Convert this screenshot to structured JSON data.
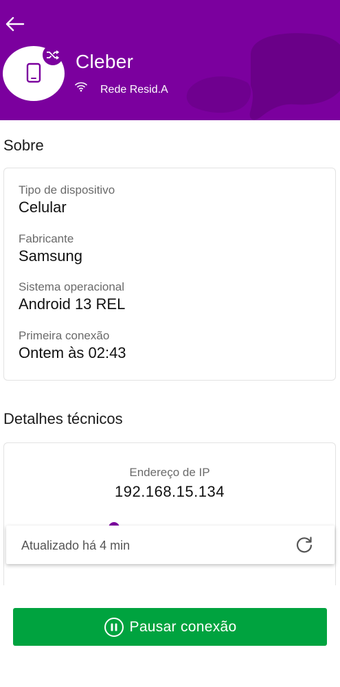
{
  "header": {
    "device_name": "Cleber",
    "network_name": "Rede Resid.A",
    "background_color": "#7b009e",
    "back_icon": "arrow-left-icon",
    "avatar_icon": "smartphone-icon",
    "badge_icon": "shuffle-icon",
    "network_icon": "wifi-icon"
  },
  "about": {
    "title": "Sobre",
    "fields": [
      {
        "label": "Tipo de dispositivo",
        "value": "Celular"
      },
      {
        "label": "Fabricante",
        "value": "Samsung"
      },
      {
        "label": "Sistema operacional",
        "value": "Android 13 REL"
      },
      {
        "label": "Primeira conexão",
        "value": "Ontem às 02:43"
      }
    ]
  },
  "technical": {
    "title": "Detalhes técnicos",
    "ip_label": "Endereço de IP",
    "ip_value": "192.168.15.134"
  },
  "update_bar": {
    "text": "Atualizado há 4 min",
    "refresh_icon": "refresh-icon"
  },
  "actions": {
    "pause_label": "Pausar conexão",
    "pause_icon": "pause-circle-icon",
    "button_color": "#00a33f"
  }
}
